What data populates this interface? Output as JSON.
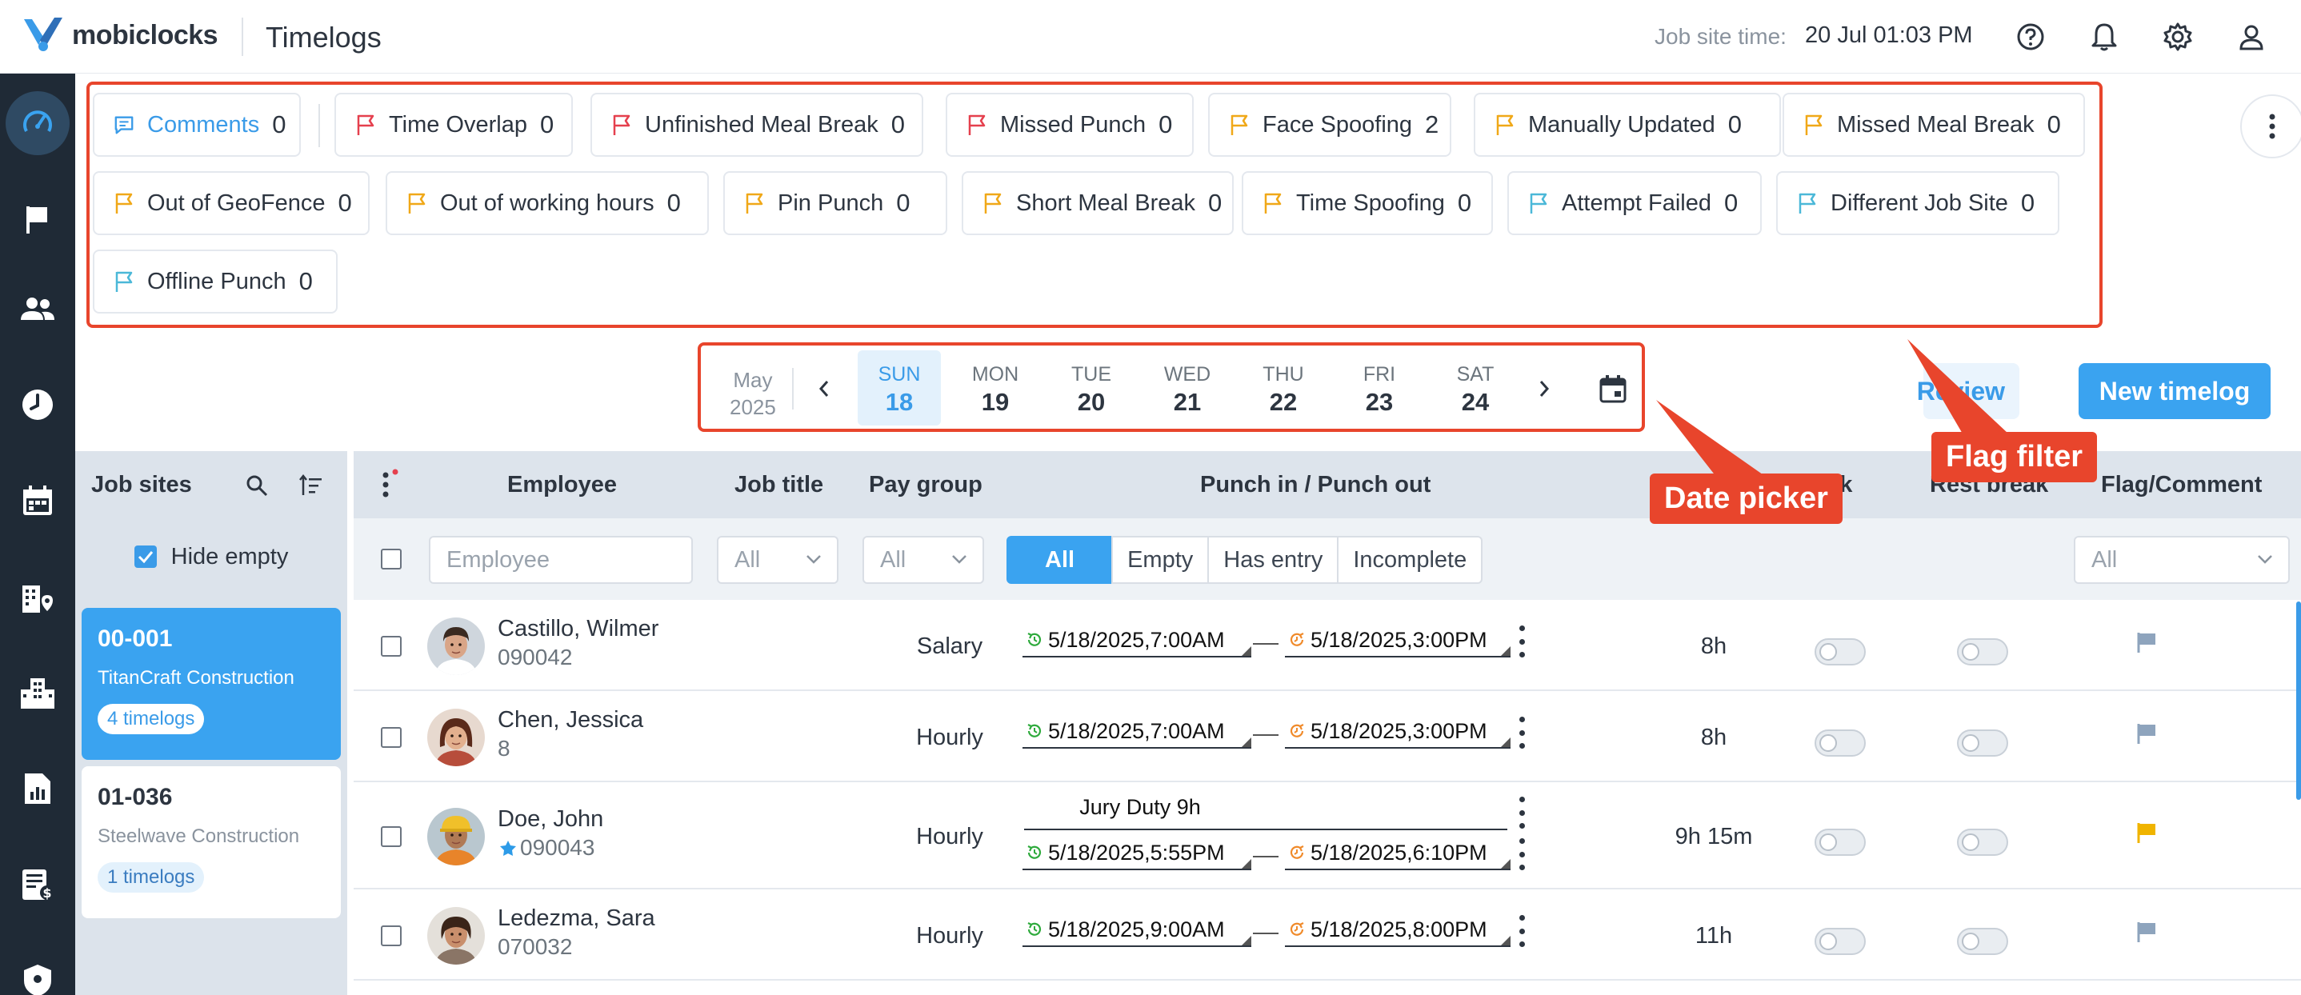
{
  "app": {
    "brand": "mobiclocks",
    "title": "Timelogs"
  },
  "topbar": {
    "job_site_time_label": "Job site time:",
    "job_site_time_value": "20 Jul 01:03 PM"
  },
  "flag_filters": [
    {
      "label": "Comments",
      "count": "0",
      "icon": "comment-icon",
      "color": "#3a9be8"
    },
    {
      "label": "Time Overlap",
      "count": "0",
      "icon": "flag-icon",
      "color": "#e5404e"
    },
    {
      "label": "Unfinished Meal Break",
      "count": "0",
      "icon": "flag-icon",
      "color": "#e5404e"
    },
    {
      "label": "Missed Punch",
      "count": "0",
      "icon": "flag-icon",
      "color": "#e5404e"
    },
    {
      "label": "Face Spoofing",
      "count": "2",
      "icon": "flag-icon",
      "color": "#f0a818"
    },
    {
      "label": "Manually Updated",
      "count": "0",
      "icon": "flag-icon",
      "color": "#f0a818"
    },
    {
      "label": "Missed Meal Break",
      "count": "0",
      "icon": "flag-icon",
      "color": "#f0a818"
    },
    {
      "label": "Out of GeoFence",
      "count": "0",
      "icon": "flag-icon",
      "color": "#f0a818"
    },
    {
      "label": "Out of working hours",
      "count": "0",
      "icon": "flag-icon",
      "color": "#f0a818"
    },
    {
      "label": "Pin Punch",
      "count": "0",
      "icon": "flag-icon",
      "color": "#f0a818"
    },
    {
      "label": "Short Meal Break",
      "count": "0",
      "icon": "flag-icon",
      "color": "#f0a818"
    },
    {
      "label": "Time Spoofing",
      "count": "0",
      "icon": "flag-icon",
      "color": "#f0a818"
    },
    {
      "label": "Attempt Failed",
      "count": "0",
      "icon": "flag-icon",
      "color": "#4bb8d8"
    },
    {
      "label": "Different Job Site",
      "count": "0",
      "icon": "flag-icon",
      "color": "#4bb8d8"
    },
    {
      "label": "Offline Punch",
      "count": "0",
      "icon": "flag-icon",
      "color": "#4bb8d8"
    }
  ],
  "date_picker": {
    "month": "May",
    "year": "2025",
    "days": [
      {
        "name": "SUN",
        "date": "18",
        "active": true
      },
      {
        "name": "MON",
        "date": "19"
      },
      {
        "name": "TUE",
        "date": "20"
      },
      {
        "name": "WED",
        "date": "21"
      },
      {
        "name": "THU",
        "date": "22"
      },
      {
        "name": "FRI",
        "date": "23"
      },
      {
        "name": "SAT",
        "date": "24"
      }
    ]
  },
  "callouts": {
    "date_picker": "Date picker",
    "flag_filter": "Flag filter"
  },
  "actions": {
    "review": "Review",
    "new_timelog": "New timelog"
  },
  "job_sites": {
    "header": "Job sites",
    "hide_empty": "Hide empty",
    "items": [
      {
        "code": "00-001",
        "name": "TitanCraft Construction",
        "badge": "4 timelogs",
        "active": true
      },
      {
        "code": "01-036",
        "name": "Steelwave Construction",
        "badge": "1 timelogs"
      }
    ]
  },
  "table": {
    "columns": {
      "employee": "Employee",
      "job_title": "Job title",
      "pay_group": "Pay group",
      "punch": "Punch in / Punch out",
      "meal_break": "break",
      "rest_break": "Rest break",
      "flag_comment": "Flag/Comment"
    },
    "filters": {
      "employee_placeholder": "Employee",
      "job_title": "All",
      "pay_group": "All",
      "segments": [
        "All",
        "Empty",
        "Has entry",
        "Incomplete"
      ],
      "flag": "All"
    },
    "rows": [
      {
        "name": "Castillo, Wilmer",
        "id": "090042",
        "pay_group": "Salary",
        "punch_in": "5/18/2025,7:00AM",
        "punch_out": "5/18/2025,3:00PM",
        "duration": "8h",
        "flag_color": "#8ea4bd"
      },
      {
        "name": "Chen, Jessica",
        "id": "8",
        "pay_group": "Hourly",
        "punch_in": "5/18/2025,7:00AM",
        "punch_out": "5/18/2025,3:00PM",
        "duration": "8h",
        "flag_color": "#8ea4bd"
      },
      {
        "name": "Doe, John",
        "id": "090043",
        "pay_group": "Hourly",
        "note": "Jury Duty 9h",
        "punch_in": "5/18/2025,5:55PM",
        "punch_out": "5/18/2025,6:10PM",
        "duration": "9h 15m",
        "flag_color": "#f0b400"
      },
      {
        "name": "Ledezma, Sara",
        "id": "070032",
        "pay_group": "Hourly",
        "punch_in": "5/18/2025,9:00AM",
        "punch_out": "5/18/2025,8:00PM",
        "duration": "11h",
        "flag_color": "#8ea4bd"
      }
    ]
  }
}
